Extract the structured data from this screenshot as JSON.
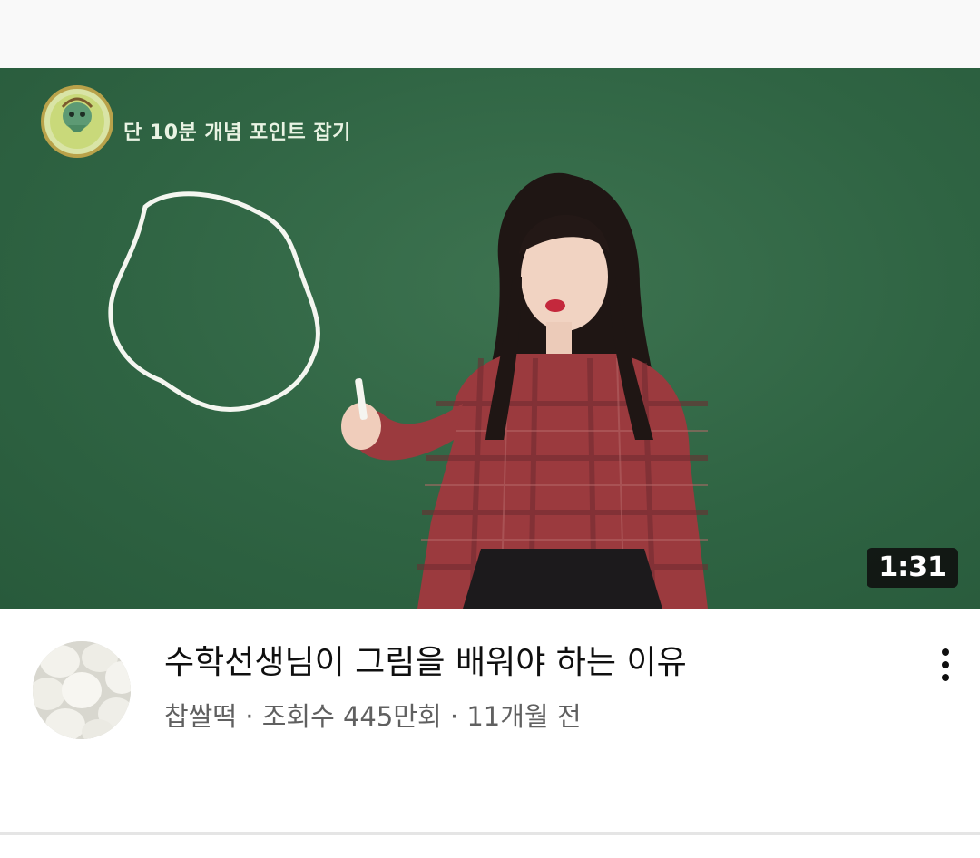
{
  "video": {
    "overlay_text": "단 10분 개념 포인트 잡기",
    "duration": "1:31",
    "colors": {
      "chalkboard": "#2f6443",
      "chalk": "#ffffff"
    }
  },
  "details": {
    "title": "수학선생님이 그림을 배워야 하는 이유",
    "channel": "찹쌀떡",
    "separator": " · ",
    "views": "조회수 445만회",
    "age": "11개월 전",
    "menu_icon": "more-vert-icon"
  }
}
